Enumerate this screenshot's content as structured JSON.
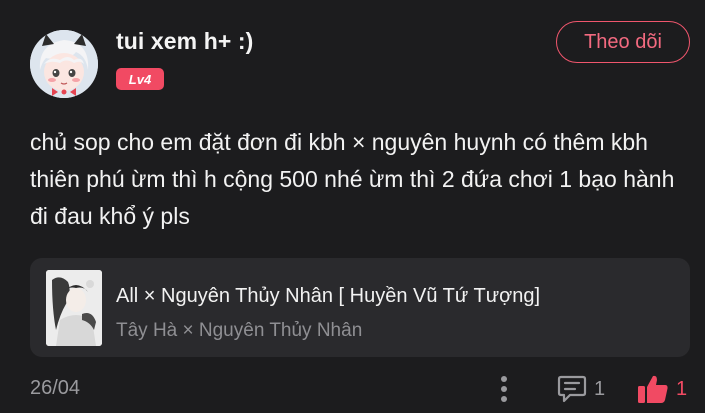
{
  "user": {
    "name": "tui xem h+ :)",
    "level": "Lv4"
  },
  "follow_label": "Theo dõi",
  "post": {
    "text": "chủ sop cho em đặt đơn đi kbh × nguyên huynh có thêm kbh thiên phú ừm thì h cộng 500 nhé ừm thì 2 đứa chơi 1 bạo hành đi đau khổ ý pls",
    "date": "26/04"
  },
  "story": {
    "title": "All × Nguyên Thủy Nhân [ Huyền Vũ Tứ Tượng]",
    "subtitle": "Tây Hà × Nguyên Thủy Nhân"
  },
  "actions": {
    "comment_count": "1",
    "like_count": "1"
  },
  "colors": {
    "background": "#1c1c1e",
    "accent": "#f14a63",
    "card": "#2a2a2d",
    "muted": "#9a9a9e"
  },
  "icons": [
    "avatar",
    "more-vertical-icon",
    "comment-icon",
    "thumbs-up-icon",
    "story-cover"
  ]
}
